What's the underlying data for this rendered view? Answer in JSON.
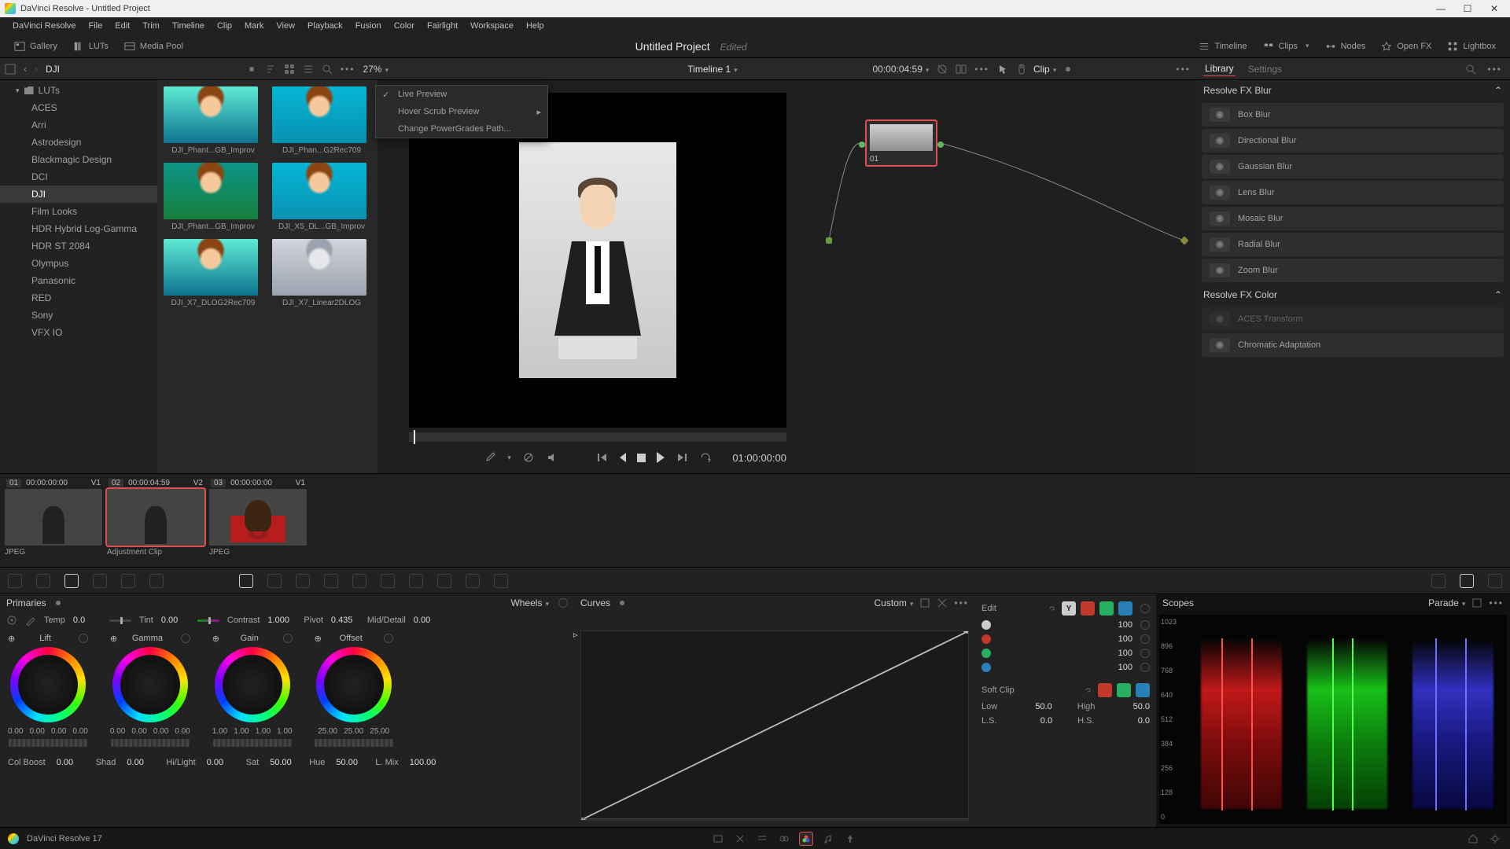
{
  "window": {
    "title": "DaVinci Resolve - Untitled Project"
  },
  "menubar": [
    "DaVinci Resolve",
    "File",
    "Edit",
    "Trim",
    "Timeline",
    "Clip",
    "Mark",
    "View",
    "Playback",
    "Fusion",
    "Color",
    "Fairlight",
    "Workspace",
    "Help"
  ],
  "toptoolbar": {
    "gallery": "Gallery",
    "luts": "LUTs",
    "mediapool": "Media Pool",
    "project_title": "Untitled Project",
    "edited": "Edited",
    "timeline": "Timeline",
    "clips": "Clips",
    "nodes": "Nodes",
    "openfx": "Open FX",
    "lightbox": "Lightbox"
  },
  "context": {
    "breadcrumb": "DJI",
    "zoom": "27%",
    "timeline_name": "Timeline 1",
    "timecode": "00:00:04:59",
    "right_label": "Clip",
    "library": "Library",
    "settings": "Settings"
  },
  "lut_tree": {
    "root": "LUTs",
    "items": [
      "ACES",
      "Arri",
      "Astrodesign",
      "Blackmagic Design",
      "DCI",
      "DJI",
      "Film Looks",
      "HDR Hybrid Log-Gamma",
      "HDR ST 2084",
      "Olympus",
      "Panasonic",
      "RED",
      "Sony",
      "VFX IO"
    ],
    "selected_index": 5
  },
  "lut_grid": [
    {
      "name": "DJI_Phant...GB_Improv"
    },
    {
      "name": "DJI_Phan...G2Rec709"
    },
    {
      "name": "DJI_Phant...GB_Improv"
    },
    {
      "name": "DJI_X5_DL...GB_Improv"
    },
    {
      "name": "DJI_X7_DLOG2Rec709"
    },
    {
      "name": "DJI_X7_Linear2DLOG"
    }
  ],
  "context_menu": {
    "live_preview": "Live Preview",
    "hover_scrub": "Hover Scrub Preview",
    "change_path": "Change PowerGrades Path..."
  },
  "viewer": {
    "tc": "01:00:00:00"
  },
  "node": {
    "label": "01"
  },
  "fx": {
    "group_blur": "Resolve FX Blur",
    "blur_items": [
      "Box Blur",
      "Directional Blur",
      "Gaussian Blur",
      "Lens Blur",
      "Mosaic Blur",
      "Radial Blur",
      "Zoom Blur"
    ],
    "group_color": "Resolve FX Color",
    "color_items": [
      "ACES Transform",
      "Chromatic Adaptation"
    ]
  },
  "thumbstrip": [
    {
      "num": "01",
      "tc": "00:00:00:00",
      "track": "V1",
      "caption": "JPEG"
    },
    {
      "num": "02",
      "tc": "00:00:04:59",
      "track": "V2",
      "caption": "Adjustment Clip"
    },
    {
      "num": "03",
      "tc": "00:00:00:00",
      "track": "V1",
      "caption": "JPEG"
    }
  ],
  "primaries": {
    "title": "Primaries",
    "wheels_label": "Wheels",
    "adjust": {
      "temp_l": "Temp",
      "temp_v": "0.0",
      "tint_l": "Tint",
      "tint_v": "0.00",
      "contrast_l": "Contrast",
      "contrast_v": "1.000",
      "pivot_l": "Pivot",
      "pivot_v": "0.435",
      "md_l": "Mid/Detail",
      "md_v": "0.00"
    },
    "wheels": [
      {
        "name": "Lift",
        "vals": [
          "0.00",
          "0.00",
          "0.00",
          "0.00"
        ]
      },
      {
        "name": "Gamma",
        "vals": [
          "0.00",
          "0.00",
          "0.00",
          "0.00"
        ]
      },
      {
        "name": "Gain",
        "vals": [
          "1.00",
          "1.00",
          "1.00",
          "1.00"
        ]
      },
      {
        "name": "Offset",
        "vals": [
          "25.00",
          "25.00",
          "25.00"
        ]
      }
    ],
    "lower": {
      "colboost_l": "Col Boost",
      "colboost_v": "0.00",
      "shad_l": "Shad",
      "shad_v": "0.00",
      "hilight_l": "Hi/Light",
      "hilight_v": "0.00",
      "sat_l": "Sat",
      "sat_v": "50.00",
      "hue_l": "Hue",
      "hue_v": "50.00",
      "lmix_l": "L. Mix",
      "lmix_v": "100.00"
    }
  },
  "curves": {
    "title": "Curves",
    "custom": "Custom",
    "edit": "Edit",
    "y_label": "Y",
    "channels": [
      {
        "val": "100"
      },
      {
        "val": "100"
      },
      {
        "val": "100"
      },
      {
        "val": "100"
      }
    ],
    "softclip": "Soft Clip",
    "low_l": "Low",
    "low_v": "50.0",
    "high_l": "High",
    "high_v": "50.0",
    "ls_l": "L.S.",
    "ls_v": "0.0",
    "hs_l": "H.S.",
    "hs_v": "0.0"
  },
  "scopes": {
    "title": "Scopes",
    "mode": "Parade",
    "ticks": [
      "1023",
      "896",
      "768",
      "640",
      "512",
      "384",
      "256",
      "128",
      "0"
    ]
  },
  "pagebar": {
    "app": "DaVinci Resolve 17"
  }
}
